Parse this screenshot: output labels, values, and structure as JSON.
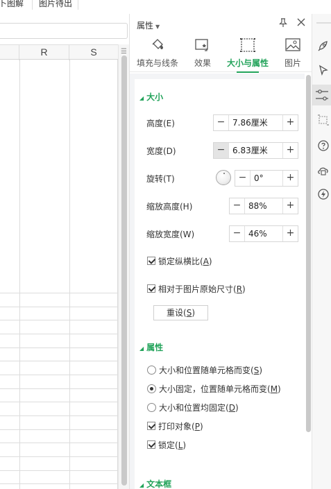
{
  "ribbon": {
    "tab_a": "卜图解",
    "tab_b": "图片待出"
  },
  "sheet": {
    "columns": [
      "R",
      "S"
    ]
  },
  "pane": {
    "title": "属性",
    "tabs": [
      {
        "label": "填充与线条",
        "icon": "fill-bucket-icon"
      },
      {
        "label": "效果",
        "icon": "effects-icon"
      },
      {
        "label": "大小与属性",
        "icon": "size-frame-icon",
        "active": true
      },
      {
        "label": "图片",
        "icon": "picture-icon"
      }
    ],
    "size_section": {
      "title": "大小",
      "height_label": "高度(E)",
      "height_value": "7.86厘米",
      "width_label": "宽度(D)",
      "width_value": "6.83厘米",
      "rotate_label": "旋转(T)",
      "rotate_value": "0°",
      "scale_height_label": "缩放高度(H)",
      "scale_height_value": "88%",
      "scale_width_label": "缩放宽度(W)",
      "scale_width_value": "46%",
      "lock_aspect_prefix": "锁定纵横比(",
      "lock_aspect_key": "A",
      "lock_aspect_suffix": ")",
      "relative_prefix": "相对于图片原始尺寸(",
      "relative_key": "R",
      "relative_suffix": ")",
      "reset_prefix": "重设(",
      "reset_key": "S",
      "reset_suffix": ")"
    },
    "props_section": {
      "title": "属性",
      "opt1_prefix": "大小和位置随单元格而变(",
      "opt1_key": "S",
      "opt2_prefix": "大小固定，位置随单元格而变(",
      "opt2_key": "M",
      "opt3_prefix": "大小和位置均固定(",
      "opt3_key": "D",
      "print_prefix": "打印对象(",
      "print_key": "P",
      "lock_prefix": "锁定(",
      "lock_key": "L",
      "close_paren": ")",
      "selected_option": 2
    },
    "textbox_section": {
      "title": "文本框"
    }
  },
  "colors": {
    "accent": "#22a35a"
  },
  "right_toolbar": {
    "icons": [
      "rocket-icon",
      "cursor-icon",
      "adjust-sliders-icon",
      "crop-frame-icon",
      "help-icon",
      "cloud-service-icon",
      "lightning-icon"
    ]
  }
}
